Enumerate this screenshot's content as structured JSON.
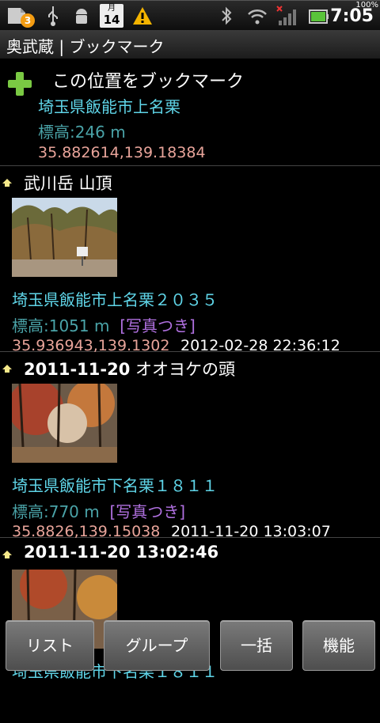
{
  "status": {
    "notification_count": "3",
    "calendar_month": "月",
    "calendar_day": "14",
    "time": "7:05",
    "battery_percent": "100%"
  },
  "title": "奥武蔵 | ブックマーク",
  "add_bookmark": {
    "label": "この位置をブックマーク",
    "address": "埼玉県飯能市上名栗",
    "elevation": "標高:246 m",
    "coords": "35.882614,139.18384"
  },
  "items": [
    {
      "title_bold": "",
      "title": "武川岳 山頂",
      "address": "埼玉県飯能市上名栗２０３５",
      "elevation": "標高:1051 m",
      "photo_tag": "[写真つき]",
      "coords": "35.936943,139.1302",
      "datetime": "2012-02-28 22:36:12"
    },
    {
      "title_bold": "2011-11-20",
      "title": " オオヨケの頭",
      "address": "埼玉県飯能市下名栗１８１１",
      "elevation": "標高:770 m",
      "photo_tag": "[写真つき]",
      "coords": "35.8826,139.15038",
      "datetime": "2011-11-20 13:03:07"
    },
    {
      "title_bold": "2011-11-20 13:02:46",
      "title": "",
      "address": "埼玉県飯能市下名栗１８１１"
    }
  ],
  "buttons": {
    "list": "リスト",
    "group": "グループ",
    "batch": "一括",
    "function": "機能"
  },
  "colors": {
    "address": "#5fd5e8",
    "elevation": "#4aa3a8",
    "coords": "#e8a49a",
    "photo_tag": "#b070e0",
    "plus": "#7ac943"
  }
}
